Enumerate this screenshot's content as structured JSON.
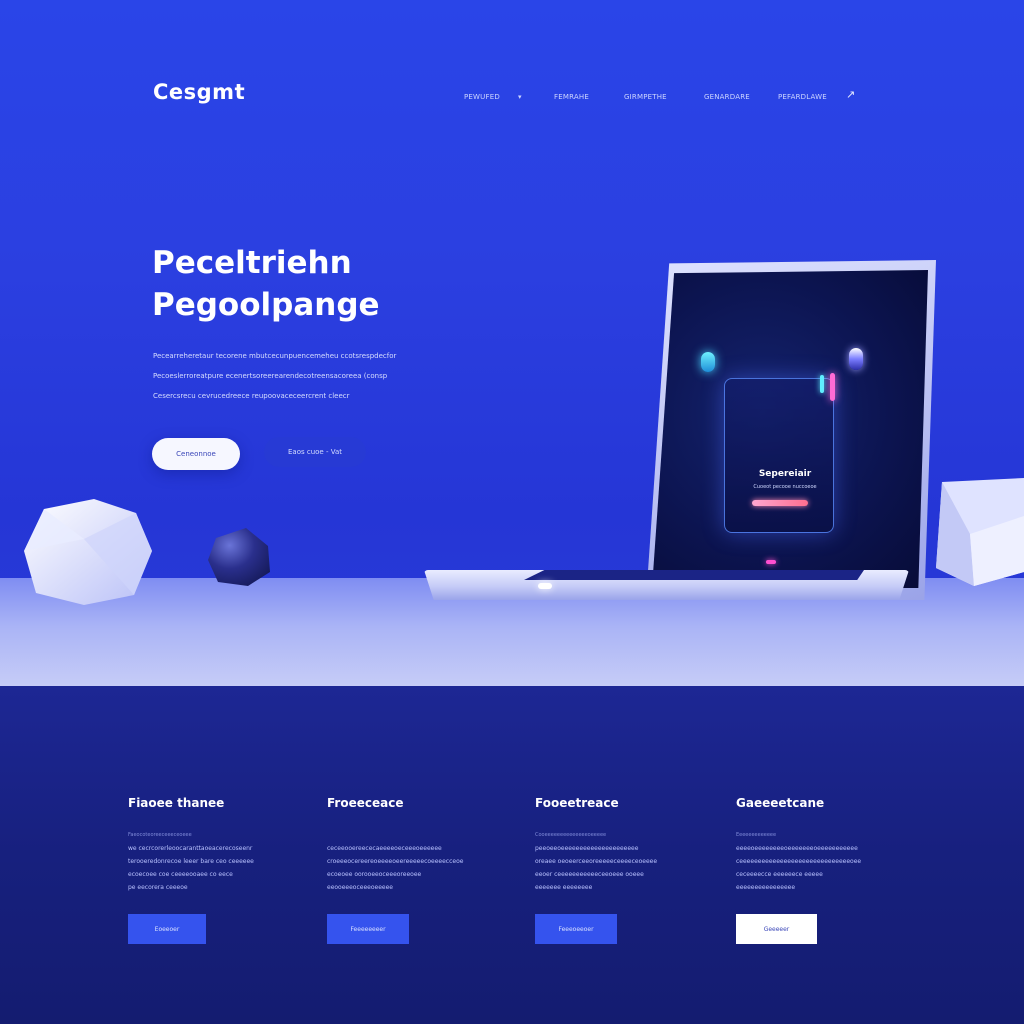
{
  "header": {
    "logo": "Cesgmt",
    "nav": [
      "PEWUFED",
      "FEMRAHE",
      "GIRMPETHE",
      "GENARDARE",
      "PEFARDLAWE"
    ]
  },
  "hero": {
    "title_line1": "Peceltriehn",
    "title_line2": "Pegoolpange",
    "description": [
      "Pecearreheretaur tecorene mbutcecunpuencemeheu ccotsrespdecfor",
      "Pecoeslerroreatpure ecenertsoreerearendecotreensacoreea (consp",
      "Cesercsrecu cevrucedreece reupoovaceceercrent cleecr"
    ],
    "primary_button": "Ceneonnoe",
    "secondary_button": "Eaos cuoe - Vat"
  },
  "laptop_screen": {
    "card_title": "Sepereiair",
    "card_subtitle": "Cuoeot pecooe nuccoeoe"
  },
  "features": [
    {
      "title": "Fiaoee thanee",
      "meta": "Faeocoteoreeceeeceoeee",
      "lines": [
        "we cecrcorerleoocaranttaoeacerecoseenr",
        "terooeredonrecoe leeer bare ceo ceeeeee",
        "ecoecoee coe ceeeeooaee co eece",
        "pe eecorera ceeeoe"
      ],
      "button": "Eoeeoer"
    },
    {
      "title": "Froeeceace",
      "meta": "",
      "lines": [
        "ceceeooereececaeeeeoeceeeoeeeeee",
        "croeeeocereereoeeeeoeereeeeecoeeeecceoe",
        "ecoeoee oorooeeoceeeoreeoee",
        "eeooeeeoceeeoeeeee"
      ],
      "button": "Feeeeeeeer"
    },
    {
      "title": "Fooeetreace",
      "meta": "Cooeeeeeeeeeeeeeeoeeeee",
      "lines": [
        "peeoeeoeeeeeeeeeeeeeeeeeeeee",
        "oreaee oeoeerceeoreeeeeceeeeceoeeee",
        "eeoer ceeeeeeeeeeeceeoeee ooeee",
        "eeeeeee eeeeeeee"
      ],
      "button": "Feeeoeeoer"
    },
    {
      "title": "Gaeeeetcane",
      "meta": "Eeeeeeeeeeeee",
      "lines": [
        "eeeeoeeeeeeeeoeeeeeeeoeeeeeeeeeee",
        "ceeeeeeeeeeeeeeeeeeeeeeeeeeeeeeoee",
        "ceceeeecce eeeeeece eeeee",
        "eeeeeeeeeeeeeeee"
      ],
      "button": "Geeeeer"
    }
  ],
  "colors": {
    "hero_bg": "#2b3fe0",
    "features_bg": "#17207e",
    "accent_button": "#3553ee",
    "glow_pink": "#ff6bd4",
    "glow_cyan": "#5ef0ff"
  },
  "icons": [
    "nav-caret-icon",
    "arrow-icon",
    "gem-decoration",
    "sphere-decoration",
    "cube-decoration"
  ]
}
